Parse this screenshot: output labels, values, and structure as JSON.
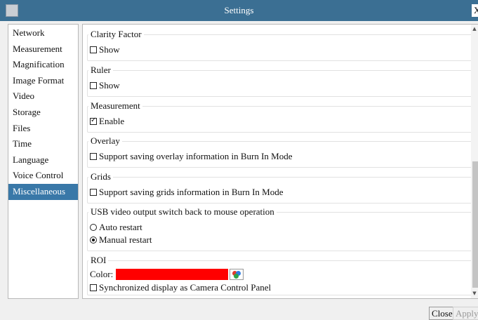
{
  "window": {
    "title": "Settings",
    "close_glyph": "X"
  },
  "sidebar": {
    "items": [
      {
        "label": "Network"
      },
      {
        "label": "Measurement"
      },
      {
        "label": "Magnification"
      },
      {
        "label": "Image Format"
      },
      {
        "label": "Video"
      },
      {
        "label": "Storage"
      },
      {
        "label": "Files"
      },
      {
        "label": "Time"
      },
      {
        "label": "Language"
      },
      {
        "label": "Voice Control"
      },
      {
        "label": "Miscellaneous",
        "selected": true
      }
    ]
  },
  "content": {
    "clarity": {
      "title": "Clarity Factor",
      "option": "Show",
      "checked": false
    },
    "ruler": {
      "title": "Ruler",
      "option": "Show",
      "checked": false
    },
    "measurement": {
      "title": "Measurement",
      "option": "Enable",
      "checked": true
    },
    "overlay": {
      "title": "Overlay",
      "option": "Support saving overlay information in Burn In Mode",
      "checked": false
    },
    "grids": {
      "title": "Grids",
      "option": "Support saving grids information in Burn In Mode",
      "checked": false
    },
    "usb": {
      "title": "USB video output switch back to mouse operation",
      "options": [
        {
          "label": "Auto restart",
          "selected": false
        },
        {
          "label": "Manual restart",
          "selected": true
        }
      ]
    },
    "roi": {
      "title": "ROI",
      "color_label": "Color:",
      "color_value": "#ff0000",
      "sync_option": "Synchronized display as Camera Control Panel",
      "sync_checked": false
    }
  },
  "footer": {
    "close_label": "Close",
    "apply_label": "Apply"
  },
  "colors": {
    "titlebar": "#3b6f93",
    "selected_item": "#3978a8",
    "roi_color": "#ff0000"
  }
}
